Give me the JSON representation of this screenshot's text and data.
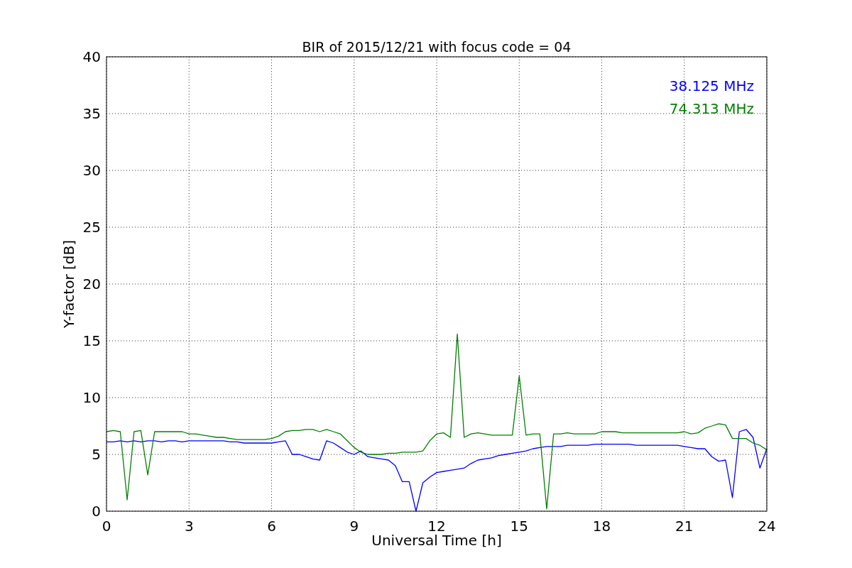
{
  "chart": {
    "chart_data": {
      "type": "line",
      "title": "BIR of 2015/12/21 with focus code = 04",
      "xlabel": "Universal Time [h]",
      "ylabel": "Y-factor [dB]",
      "x": [
        0,
        0.25,
        0.5,
        0.75,
        1,
        1.25,
        1.5,
        1.75,
        2,
        2.25,
        2.5,
        2.75,
        3,
        3.25,
        3.5,
        3.75,
        4,
        4.25,
        4.5,
        4.75,
        5,
        5.25,
        5.5,
        5.75,
        6,
        6.25,
        6.5,
        6.75,
        7,
        7.25,
        7.5,
        7.75,
        8,
        8.25,
        8.5,
        8.75,
        9,
        9.25,
        9.5,
        9.75,
        10,
        10.25,
        10.5,
        10.75,
        11,
        11.25,
        11.5,
        11.75,
        12,
        12.25,
        12.5,
        12.75,
        13,
        13.25,
        13.5,
        13.75,
        14,
        14.25,
        14.5,
        14.75,
        15,
        15.25,
        15.5,
        15.75,
        16,
        16.25,
        16.5,
        16.75,
        17,
        17.25,
        17.5,
        17.75,
        18,
        18.25,
        18.5,
        18.75,
        19,
        19.25,
        19.5,
        19.75,
        20,
        20.25,
        20.5,
        20.75,
        21,
        21.25,
        21.5,
        21.75,
        22,
        22.25,
        22.5,
        22.75,
        23,
        23.25,
        23.5,
        23.75,
        24
      ],
      "series": [
        {
          "name": "38.125 MHz",
          "color": "#0000ff",
          "values": [
            6.1,
            6.1,
            6.2,
            6.1,
            6.2,
            6.1,
            6.2,
            6.2,
            6.1,
            6.2,
            6.2,
            6.1,
            6.2,
            6.2,
            6.2,
            6.2,
            6.2,
            6.2,
            6.1,
            6.1,
            6.0,
            6.0,
            6.0,
            6.0,
            6.0,
            6.1,
            6.2,
            5.0,
            5.0,
            4.8,
            4.6,
            4.5,
            6.2,
            6.0,
            5.6,
            5.2,
            5.0,
            5.3,
            4.8,
            4.7,
            4.6,
            4.5,
            4.0,
            2.6,
            2.6,
            0.0,
            2.5,
            3.0,
            3.4,
            3.5,
            3.6,
            3.7,
            3.8,
            4.2,
            4.5,
            4.6,
            4.7,
            4.9,
            5.0,
            5.1,
            5.2,
            5.3,
            5.5,
            5.6,
            5.7,
            5.7,
            5.7,
            5.8,
            5.8,
            5.8,
            5.8,
            5.9,
            5.9,
            5.9,
            5.9,
            5.9,
            5.9,
            5.8,
            5.8,
            5.8,
            5.8,
            5.8,
            5.8,
            5.8,
            5.7,
            5.6,
            5.5,
            5.5,
            4.8,
            4.4,
            4.5,
            1.2,
            7.0,
            7.2,
            6.5,
            3.8,
            5.5
          ]
        },
        {
          "name": "74.313 MHz",
          "color": "#008000",
          "values": [
            7.0,
            7.1,
            7.0,
            1.0,
            7.0,
            7.1,
            3.2,
            7.0,
            7.0,
            7.0,
            7.0,
            7.0,
            6.8,
            6.8,
            6.7,
            6.6,
            6.5,
            6.5,
            6.4,
            6.3,
            6.3,
            6.3,
            6.3,
            6.3,
            6.4,
            6.6,
            7.0,
            7.1,
            7.1,
            7.2,
            7.2,
            7.0,
            7.2,
            7.0,
            6.8,
            6.2,
            5.6,
            5.2,
            5.0,
            5.0,
            5.0,
            5.1,
            5.1,
            5.2,
            5.2,
            5.2,
            5.3,
            6.2,
            6.8,
            6.9,
            6.5,
            15.6,
            6.5,
            6.8,
            6.9,
            6.8,
            6.7,
            6.7,
            6.7,
            6.7,
            11.9,
            6.7,
            6.8,
            6.8,
            0.2,
            6.8,
            6.8,
            6.9,
            6.8,
            6.8,
            6.8,
            6.8,
            7.0,
            7.0,
            7.0,
            6.9,
            6.9,
            6.9,
            6.9,
            6.9,
            6.9,
            6.9,
            6.9,
            6.9,
            7.0,
            6.8,
            6.9,
            7.3,
            7.5,
            7.7,
            7.6,
            6.4,
            6.4,
            6.4,
            6.0,
            5.8,
            5.4
          ]
        }
      ],
      "grid": true,
      "xlim": [
        0,
        24
      ],
      "ylim": [
        0,
        40
      ],
      "xticks": [
        0,
        3,
        6,
        9,
        12,
        15,
        18,
        21,
        24
      ],
      "yticks": [
        0,
        5,
        10,
        15,
        20,
        25,
        30,
        35,
        40
      ]
    }
  }
}
